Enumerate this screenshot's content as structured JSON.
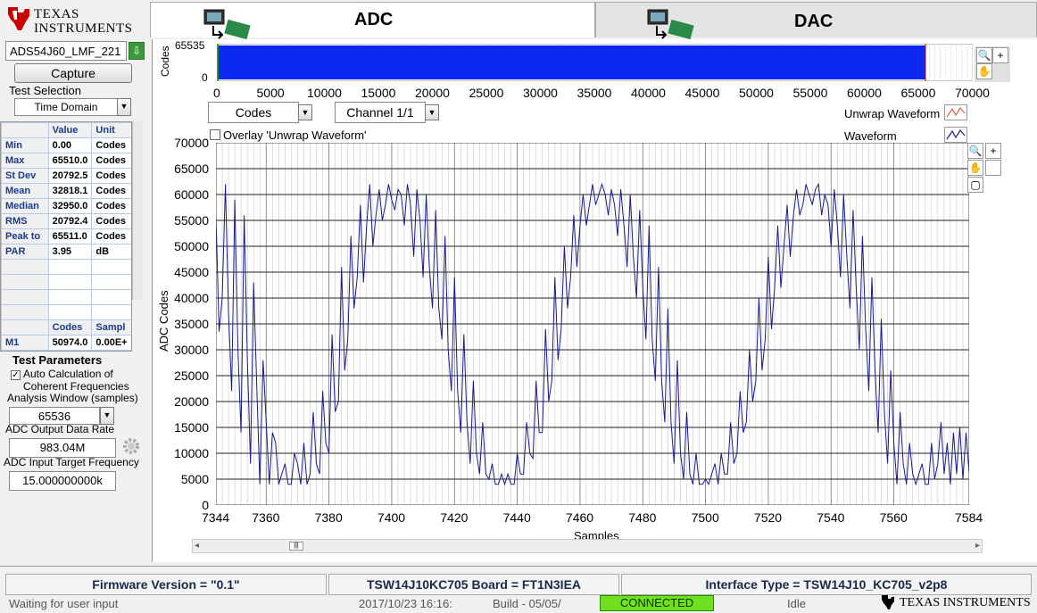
{
  "logo": {
    "line1": "Texas",
    "line2": "Instruments"
  },
  "device": {
    "value": "ADS54J60_LMF_221"
  },
  "capture_label": "Capture",
  "test_selection": {
    "label": "Test Selection",
    "value": "Time Domain"
  },
  "stats": {
    "headers": [
      "",
      "Value",
      "Unit"
    ],
    "rows": [
      {
        "name": "Min",
        "value": "0.00",
        "unit": "Codes"
      },
      {
        "name": "Max",
        "value": "65510.0",
        "unit": "Codes"
      },
      {
        "name": "St Dev",
        "value": "20792.5",
        "unit": "Codes"
      },
      {
        "name": "Mean",
        "value": "32818.1",
        "unit": "Codes"
      },
      {
        "name": "Median",
        "value": "32950.0",
        "unit": "Codes"
      },
      {
        "name": "RMS",
        "value": "20792.4",
        "unit": "Codes"
      },
      {
        "name": "Peak to",
        "value": "65511.0",
        "unit": "Codes"
      },
      {
        "name": "PAR",
        "value": "3.95",
        "unit": "dB"
      }
    ],
    "marker_headers": [
      "",
      "Codes",
      "Sampl"
    ],
    "marker_row": {
      "name": "M1",
      "codes": "50974.0",
      "samples": "0.00E+"
    }
  },
  "test_params": {
    "title": "Test Parameters",
    "auto_calc": "Auto Calculation of",
    "auto_calc2": "Coherent Frequencies",
    "window_label": "Analysis Window (samples)",
    "window_value": "65536",
    "rate_label": "ADC Output Data Rate",
    "rate_value": "983.04M",
    "target_label": "ADC Input Target Frequency",
    "target_value": "15.000000000k"
  },
  "tabs": {
    "adc": "ADC",
    "dac": "DAC"
  },
  "overview": {
    "ylabel": "Codes",
    "yticks": [
      "65535",
      "0"
    ],
    "xticks": [
      "0",
      "5000",
      "10000",
      "15000",
      "20000",
      "25000",
      "30000",
      "35000",
      "40000",
      "45000",
      "50000",
      "55000",
      "60000",
      "65000",
      "70000"
    ]
  },
  "controls": {
    "unit_select": "Codes",
    "channel_select": "Channel 1/1",
    "overlay": "Overlay 'Unwrap Waveform'",
    "legend_unwrap": "Unwrap Waveform",
    "legend_waveform": "Waveform"
  },
  "chart_data": {
    "type": "line",
    "xlabel": "Samples",
    "ylabel": "ADC Codes",
    "xlim": [
      7344,
      7584
    ],
    "ylim": [
      0,
      70000
    ],
    "xticks": [
      "7344",
      "7360",
      "7380",
      "7400",
      "7420",
      "7440",
      "7460",
      "7480",
      "7500",
      "7520",
      "7540",
      "7560",
      "7584"
    ],
    "yticks": [
      "0",
      "5000",
      "10000",
      "15000",
      "20000",
      "25000",
      "30000",
      "35000",
      "40000",
      "45000",
      "50000",
      "55000",
      "60000",
      "65000",
      "70000"
    ],
    "series": [
      {
        "name": "Waveform",
        "color": "#1a1a8a",
        "x_start": 7344,
        "x_step": 1,
        "values": [
          56000,
          33500,
          40000,
          62000,
          37000,
          22000,
          59000,
          30000,
          14000,
          56000,
          28000,
          8000,
          43000,
          23000,
          4000,
          28000,
          16000,
          4000,
          14000,
          12000,
          4000,
          6000,
          8000,
          4000,
          4000,
          10000,
          8000,
          4000,
          12000,
          4000,
          6000,
          18000,
          8000,
          6000,
          22000,
          12000,
          10000,
          33000,
          18000,
          20000,
          46000,
          26000,
          32000,
          52000,
          38000,
          44000,
          58000,
          43000,
          54000,
          62000,
          50000,
          56000,
          61000,
          55000,
          58000,
          62000,
          59000,
          57000,
          61000,
          60000,
          54000,
          62000,
          58000,
          48000,
          61000,
          55000,
          44000,
          60000,
          46000,
          38000,
          57000,
          38000,
          32000,
          52000,
          30000,
          22000,
          44000,
          22000,
          14000,
          33000,
          16000,
          8000,
          24000,
          10000,
          6000,
          16000,
          6000,
          5000,
          8000,
          4000,
          4000,
          6000,
          4000,
          6000,
          4000,
          4000,
          10000,
          6000,
          6000,
          16000,
          10000,
          9000,
          24000,
          14000,
          14000,
          34000,
          20000,
          24000,
          44000,
          28000,
          34000,
          50000,
          38000,
          44000,
          56000,
          46000,
          54000,
          60000,
          54000,
          58000,
          62000,
          58000,
          60000,
          62000,
          60000,
          56000,
          61000,
          58000,
          52000,
          61000,
          54000,
          46000,
          60000,
          48000,
          40000,
          57000,
          42000,
          32000,
          54000,
          32000,
          24000,
          46000,
          24000,
          16000,
          38000,
          16000,
          8000,
          28000,
          10000,
          5000,
          18000,
          6000,
          4000,
          10000,
          4000,
          4000,
          5000,
          4000,
          6000,
          8000,
          4000,
          10000,
          6000,
          6000,
          16000,
          8000,
          10000,
          22000,
          14000,
          16000,
          30000,
          20000,
          24000,
          40000,
          26000,
          32000,
          48000,
          34000,
          42000,
          54000,
          42000,
          50000,
          58000,
          48000,
          56000,
          61000,
          56000,
          58000,
          62000,
          60000,
          58000,
          61000,
          62000,
          56000,
          60000,
          58000,
          50000,
          61000,
          54000,
          44000,
          60000,
          48000,
          38000,
          57000,
          42000,
          30000,
          52000,
          34000,
          22000,
          44000,
          26000,
          14000,
          36000,
          18000,
          8000,
          26000,
          12000,
          4000,
          18000,
          8000,
          4000,
          12000,
          6000,
          4000,
          6000,
          8000,
          4000,
          4000,
          12000,
          5000,
          8000,
          16000,
          6000,
          12000,
          4000,
          14000,
          6000,
          15000,
          5000,
          14000,
          6000,
          12000,
          5000,
          4000,
          15000,
          10000,
          5000,
          16000,
          15000
        ]
      }
    ]
  },
  "status": {
    "firmware": "Firmware Version = \"0.1\"",
    "board": "TSW14J10KC705 Board = FT1N3IEA",
    "interface": "Interface Type = TSW14J10_KC705_v2p8",
    "message": "Waiting for user input",
    "timestamp": "2017/10/23 16:16:",
    "build": "Build  - 05/05/",
    "connection": "CONNECTED",
    "state": "Idle"
  },
  "colors": {
    "waveform": "#1a1a8a",
    "overview_fill": "#0a28f0",
    "connected": "#6ee020",
    "ti_red": "#cc0000"
  }
}
